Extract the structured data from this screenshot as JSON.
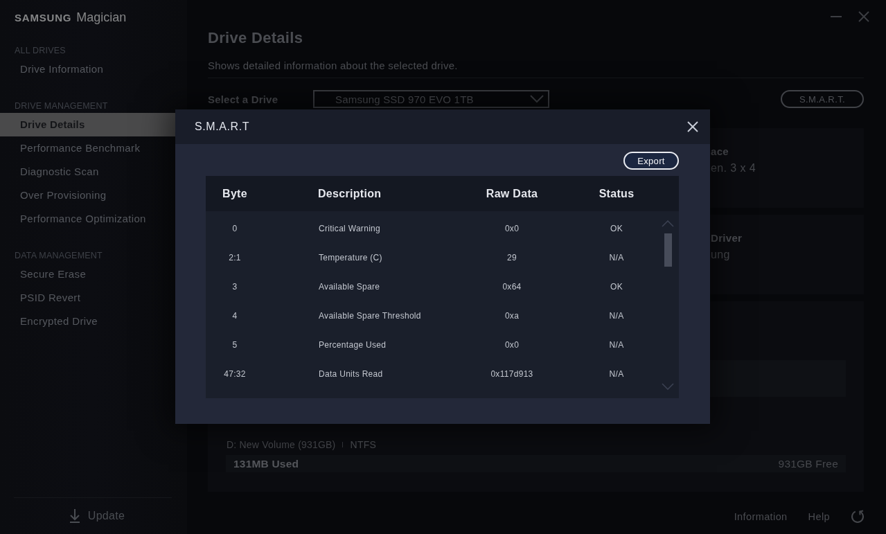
{
  "sidebar": {
    "logo": "**SAMSUNG** Magician",
    "sections": [
      {
        "title": "ALL DRIVES",
        "items": [
          {
            "label": "Drive Information",
            "selected": false
          }
        ]
      },
      {
        "title": "DRIVE MANAGEMENT",
        "items": [
          {
            "label": "Drive Details",
            "selected": true
          },
          {
            "label": "Performance Benchmark",
            "selected": false
          },
          {
            "label": "Diagnostic Scan",
            "selected": false
          },
          {
            "label": "Over Provisioning",
            "selected": false
          },
          {
            "label": "Performance Optimization",
            "selected": false
          }
        ]
      },
      {
        "title": "DATA MANAGEMENT",
        "items": [
          {
            "label": "Secure Erase",
            "selected": false
          },
          {
            "label": "PSID Revert",
            "selected": false
          },
          {
            "label": "Encrypted Drive",
            "selected": false
          }
        ]
      }
    ],
    "update_button": "Update"
  },
  "page": {
    "title": "Drive Details",
    "subtitle": "Shows detailed information about the selected drive.",
    "drive_select": {
      "label": "Select a Drive",
      "value": "Samsung SSD 970 EVO 1TB"
    },
    "smart_button": "S.M.A.R.T.",
    "info_cards": [
      {
        "heading": "ace",
        "value": "en. 3 x 4"
      },
      {
        "heading": "Driver",
        "value": "ung"
      }
    ],
    "volume": {
      "name": "D: New Volume (931GB)",
      "file_system": "NTFS",
      "used": "131MB Used",
      "free": "931GB Free"
    }
  },
  "footer": {
    "links": [
      "Information",
      "Help"
    ]
  },
  "dialog": {
    "title": "S.M.A.R.T",
    "export_button": "Export",
    "columns": [
      "Byte",
      "Description",
      "Raw Data",
      "Status"
    ],
    "rows": [
      {
        "byte": "0",
        "description": "Critical Warning",
        "raw_data": "0x0",
        "status": "OK"
      },
      {
        "byte": "2:1",
        "description": "Temperature (C)",
        "raw_data": "29",
        "status": "N/A"
      },
      {
        "byte": "3",
        "description": "Available Spare",
        "raw_data": "0x64",
        "status": "OK"
      },
      {
        "byte": "4",
        "description": "Available Spare Threshold",
        "raw_data": "0xa",
        "status": "N/A"
      },
      {
        "byte": "5",
        "description": "Percentage Used",
        "raw_data": "0x0",
        "status": "N/A"
      },
      {
        "byte": "47:32",
        "description": "Data Units Read",
        "raw_data": "0x117d913",
        "status": "N/A"
      }
    ]
  }
}
